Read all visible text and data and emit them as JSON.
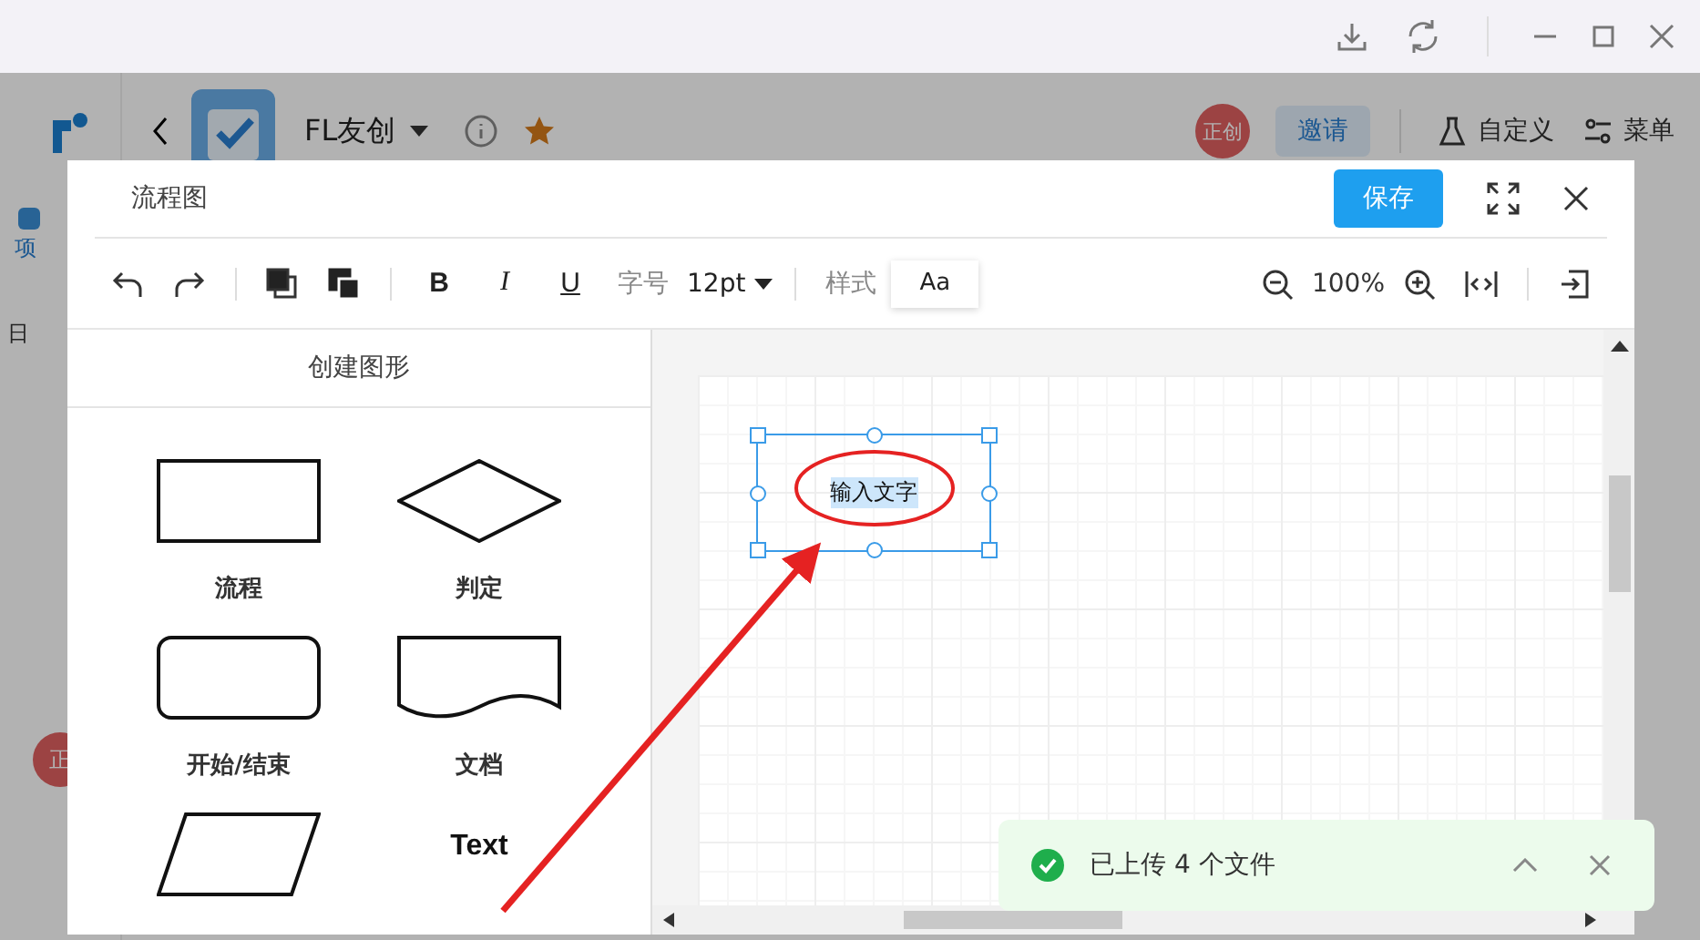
{
  "app": {
    "title": "FL友创",
    "avatar": "正创",
    "invite": "邀请",
    "actions": [
      {
        "kind": "flask",
        "label": "自定义"
      },
      {
        "kind": "sliders",
        "label": "菜单"
      }
    ],
    "rail": [
      "项",
      "日"
    ],
    "rail_avatar": "正"
  },
  "modal": {
    "title": "流程图",
    "save": "保存",
    "toolbar": {
      "format": [
        "B",
        "I",
        "U"
      ],
      "font_size_label": "字号",
      "font_size": "12pt",
      "style_label": "样式",
      "style_value": "Aa",
      "zoom": "100%"
    }
  },
  "panel": {
    "title": "创建图形",
    "shapes": [
      {
        "kind": "process",
        "label": "流程"
      },
      {
        "kind": "decision",
        "label": "判定"
      },
      {
        "kind": "terminator",
        "label": "开始/结束"
      },
      {
        "kind": "document",
        "label": "文档"
      },
      {
        "kind": "data"
      },
      {
        "kind": "text",
        "label": "Text"
      }
    ]
  },
  "canvas": {
    "node": {
      "text": "输入文字",
      "selected": true
    }
  },
  "toast": {
    "message": "已上传 4 个文件"
  }
}
